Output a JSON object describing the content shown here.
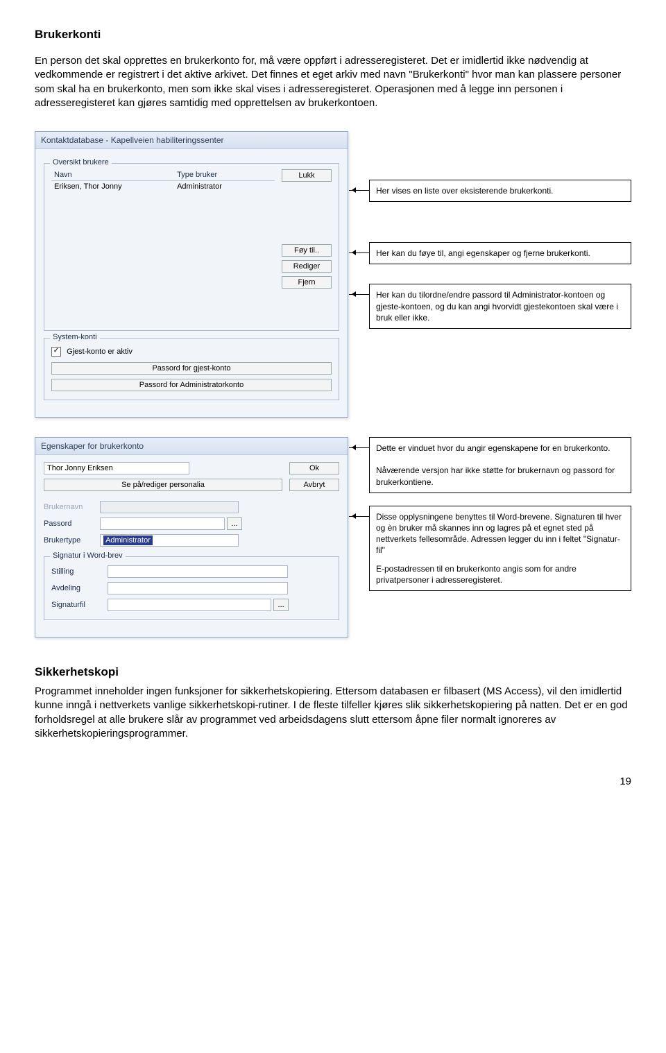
{
  "heading1": "Brukerkonti",
  "intro": "En person det skal opprettes en brukerkonto for, må være oppført i adresseregisteret. Det er imidlertid ikke nødvendig at vedkommende er registrert i det aktive arkivet. Det finnes et eget arkiv med navn \"Brukerkonti\" hvor man kan plassere personer som skal ha en brukerkonto, men som ikke skal vises i adresseregisteret. Operasjonen med å legge inn personen i adresseregisteret kan gjøres samtidig med opprettelsen av brukerkontoen.",
  "win1": {
    "title": "Kontaktdatabase - Kapellveien habiliteringssenter",
    "group1": "Oversikt brukere",
    "col_navn": "Navn",
    "col_type": "Type bruker",
    "row_navn": "Eriksen, Thor Jonny",
    "row_type": "Administrator",
    "btn_lukk": "Lukk",
    "btn_foy": "Føy til..",
    "btn_rediger": "Rediger",
    "btn_fjern": "Fjern",
    "group2": "System-konti",
    "chk_gjest": "Gjest-konto er aktiv",
    "btn_pwgjest": "Passord for gjest-konto",
    "btn_pwadmin": "Passord for Administratorkonto"
  },
  "ann1": "Her vises en liste over eksisterende brukerkonti.",
  "ann2": "Her kan du føye til, angi egenskaper og fjerne brukerkonti.",
  "ann3": "Her kan du tilordne/endre passord til Administrator-kontoen og gjeste-kontoen, og du kan angi hvorvidt gjestekontoen skal være i bruk eller ikke.",
  "win2": {
    "title": "Egenskaper for brukerkonto",
    "name_val": "Thor Jonny Eriksen",
    "btn_personalia": "Se på/rediger personalia",
    "btn_ok": "Ok",
    "btn_avbryt": "Avbryt",
    "lbl_brukernavn": "Brukernavn",
    "lbl_passord": "Passord",
    "lbl_brukertype": "Brukertype",
    "val_brukertype": "Administrator",
    "group_sig": "Signatur i Word-brev",
    "lbl_stilling": "Stilling",
    "lbl_avdeling": "Avdeling",
    "lbl_sigfil": "Signaturfil"
  },
  "ann4": "Dette er vinduet hvor du angir egenskapene for en brukerkonto.\n\nNåværende versjon har ikke støtte for brukernavn og passord for brukerkontiene.",
  "ann5a": "Disse opplysningene benyttes til Word-brevene. Signaturen til hver og èn bruker må skannes inn og lagres på et egnet sted på nettverkets fellesområde. Adressen legger du inn i feltet \"Signatur-fil\"",
  "ann5b": "E-postadressen til en brukerkonto angis som for andre privatpersoner i adresseregisteret.",
  "heading2": "Sikkerhetskopi",
  "footer_text": "Programmet inneholder ingen funksjoner for sikkerhetskopiering. Ettersom databasen er filbasert (MS Access), vil den imidlertid kunne inngå i nettverkets vanlige sikkerhetskopi-rutiner. I de fleste tilfeller kjøres slik sikkerhetskopiering på natten. Det er en god forholdsregel at alle brukere slår av programmet ved arbeidsdagens slutt ettersom åpne filer normalt ignoreres av sikkerhetskopieringsprogrammer.",
  "page_number": "19"
}
